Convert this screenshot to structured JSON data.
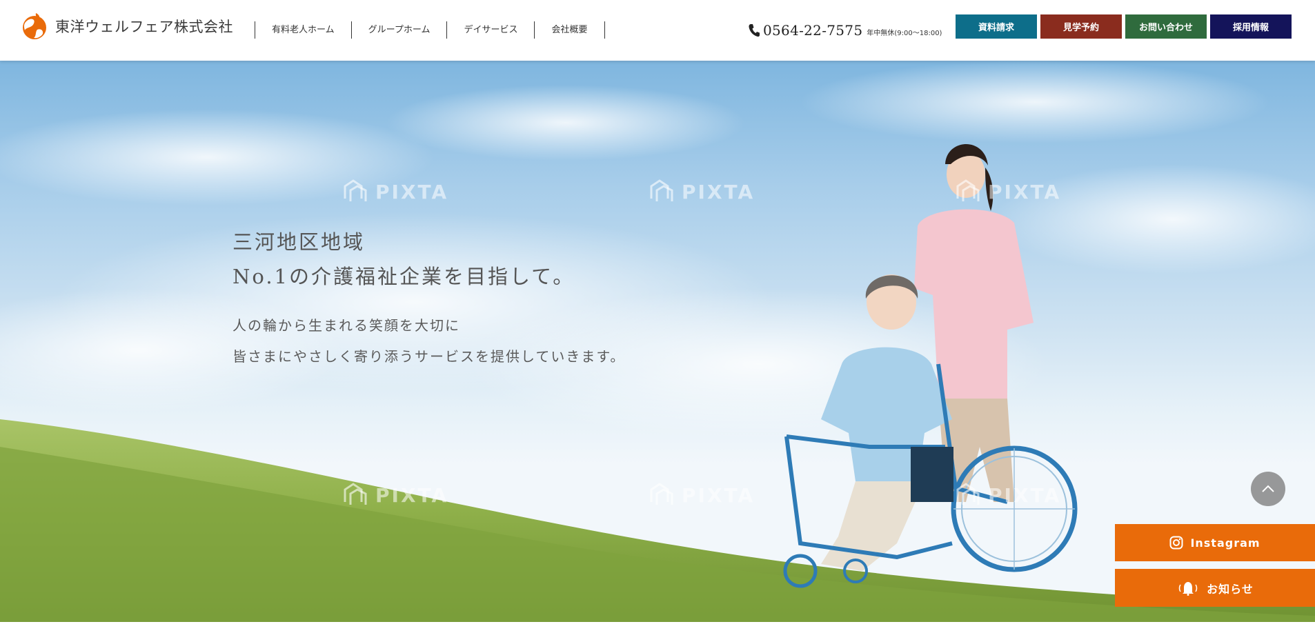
{
  "header": {
    "company_name": "東洋ウェルフェア株式会社",
    "nav": [
      {
        "label": "有料老人ホーム"
      },
      {
        "label": "グループホーム"
      },
      {
        "label": "デイサービス"
      },
      {
        "label": "会社概要"
      }
    ],
    "phone": "0564-22-7575",
    "hours": "年中無休(9:00〜18:00)",
    "buttons": [
      {
        "label": "資料請求",
        "color": "#0d6e8a"
      },
      {
        "label": "見学予約",
        "color": "#8a2c1e"
      },
      {
        "label": "お問い合わせ",
        "color": "#2f6b3d"
      },
      {
        "label": "採用情報",
        "color": "#14145a"
      }
    ]
  },
  "hero": {
    "title_line1": "三河地区地域",
    "title_line2": "No.1の介護福祉企業を目指して。",
    "sub_line1": "人の輪から生まれる笑顔を大切に",
    "sub_line2": "皆さまにやさしく寄り添うサービスを提供していきます。",
    "watermark": "PIXTA"
  },
  "side": {
    "instagram_label": "Instagram",
    "notice_label": "お知らせ",
    "accent": "#e96b0a"
  },
  "icons": {
    "logo": "globe-logo-icon",
    "phone": "phone-icon",
    "pagetop": "chevron-up-icon",
    "instagram": "instagram-icon",
    "notice": "bell-icon"
  }
}
